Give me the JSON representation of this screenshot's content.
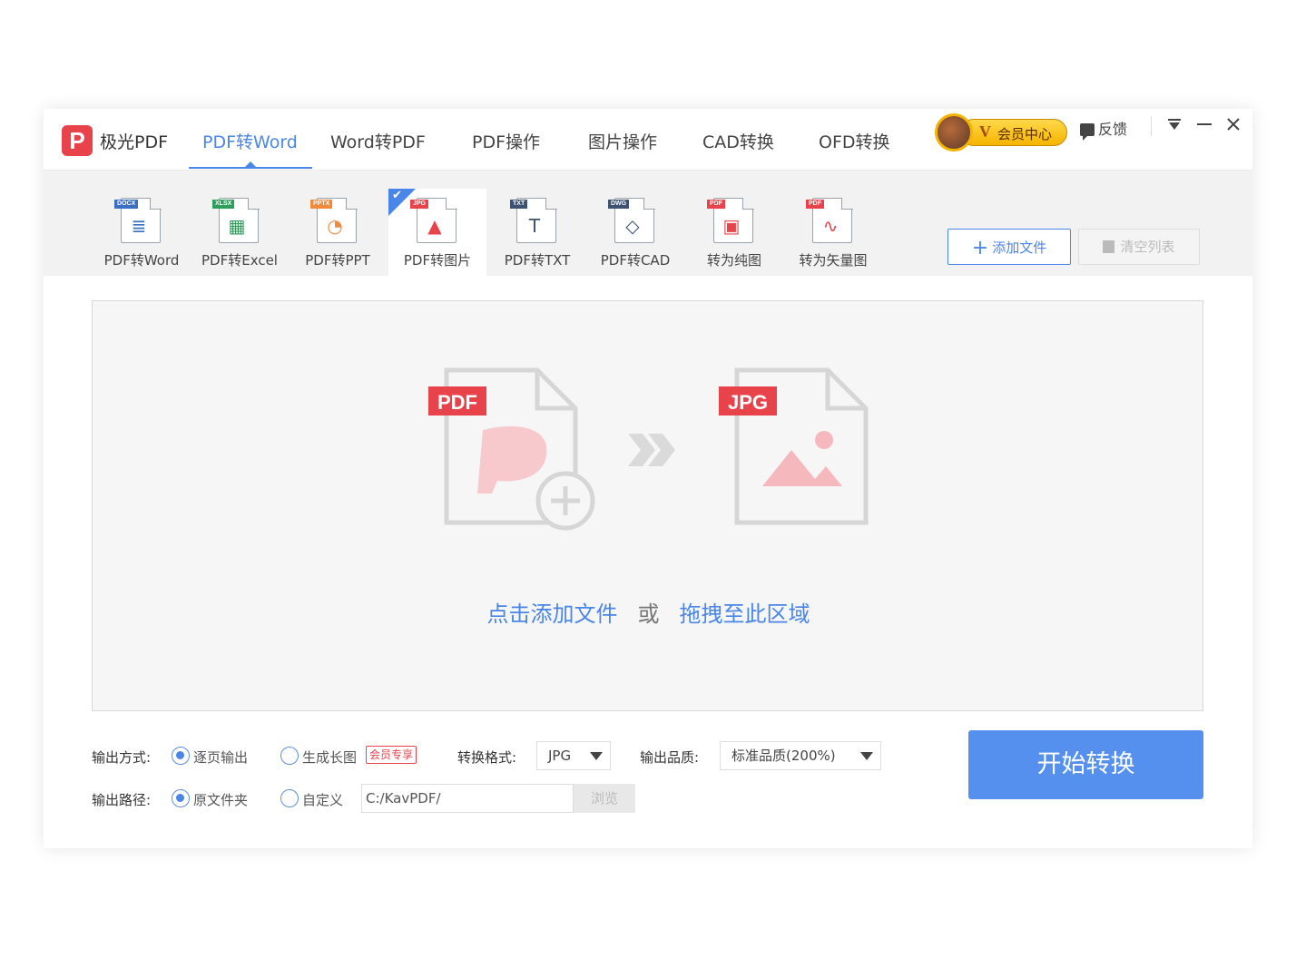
{
  "app": {
    "name": "极光PDF",
    "logo_letter": "P"
  },
  "tabs": [
    {
      "label": "PDF转Word",
      "active": true
    },
    {
      "label": "Word转PDF"
    },
    {
      "label": "PDF操作"
    },
    {
      "label": "图片操作"
    },
    {
      "label": "CAD转换"
    },
    {
      "label": "OFD转换"
    }
  ],
  "header": {
    "vip_label": "会员中心",
    "vip_letter": "V",
    "feedback_label": "反馈"
  },
  "tools": [
    {
      "label": "PDF转Word",
      "badge": "DOCX",
      "badge_color": "#3b6fc4"
    },
    {
      "label": "PDF转Excel",
      "badge": "XLSX",
      "badge_color": "#2e9e5b"
    },
    {
      "label": "PDF转PPT",
      "badge": "PPTX",
      "badge_color": "#f08a3c"
    },
    {
      "label": "PDF转图片",
      "badge": "JPG",
      "badge_color": "#e8434b",
      "active": true
    },
    {
      "label": "PDF转TXT",
      "badge": "TXT",
      "badge_color": "#3d5170"
    },
    {
      "label": "PDF转CAD",
      "badge": "DWG",
      "badge_color": "#3d5170"
    },
    {
      "label": "转为纯图",
      "badge": "PDF",
      "badge_color": "#e8434b"
    },
    {
      "label": "转为矢量图",
      "badge": "PDF",
      "badge_color": "#e8434b"
    }
  ],
  "toolbar": {
    "add_label": "添加文件",
    "clear_label": "清空列表"
  },
  "dropzone": {
    "source_badge": "PDF",
    "target_badge": "JPG",
    "hint_click": "点击添加文件",
    "hint_or": "或",
    "hint_drag": "拖拽至此区域"
  },
  "options": {
    "output_mode_label": "输出方式:",
    "mode_per_page": "逐页输出",
    "mode_long_image": "生成长图",
    "vip_only_tag": "会员专享",
    "format_label": "转换格式:",
    "format_value": "JPG",
    "quality_label": "输出品质:",
    "quality_value": "标准品质(200%)",
    "path_label": "输出路径:",
    "path_original": "原文件夹",
    "path_custom": "自定义",
    "path_value": "C:/KavPDF/",
    "browse_label": "浏览",
    "start_label": "开始转换"
  },
  "colors": {
    "accent": "#4a86e8",
    "brand_red": "#e8434b",
    "start_button": "#5590ee"
  }
}
